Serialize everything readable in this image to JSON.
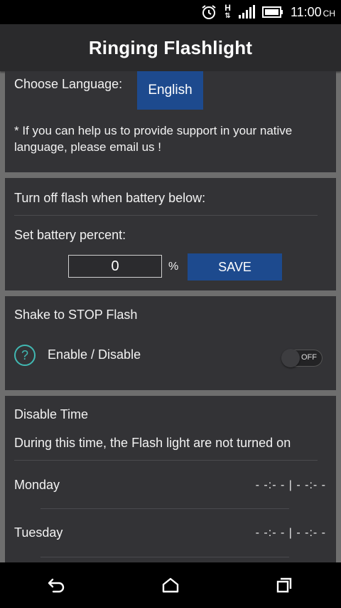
{
  "status_bar": {
    "time": "11:00",
    "time_suffix": "CH",
    "network_letter": "H"
  },
  "app": {
    "title": "Ringing Flashlight"
  },
  "language_card": {
    "label": "Choose Language:",
    "button": "English",
    "note": "* If you can help us to provide support in your native language, please email us !"
  },
  "battery_card": {
    "heading": "Turn off flash when battery below:",
    "label": "Set battery percent:",
    "value": "0",
    "unit": "%",
    "save": "SAVE"
  },
  "shake_card": {
    "heading": "Shake to STOP Flash",
    "help_glyph": "?",
    "label": "Enable / Disable",
    "toggle_text": "OFF",
    "toggle_on": false
  },
  "disable_time_card": {
    "heading": "Disable Time",
    "description": "During this time, the Flash light are not turned on",
    "days": [
      {
        "day": "Monday",
        "time": "- -:- -  |  - -:- -"
      },
      {
        "day": "Tuesday",
        "time": "- -:- -  |  - -:- -"
      }
    ]
  },
  "nav_bar": {
    "icons": [
      "back-icon",
      "home-icon",
      "recent-apps-icon"
    ]
  }
}
